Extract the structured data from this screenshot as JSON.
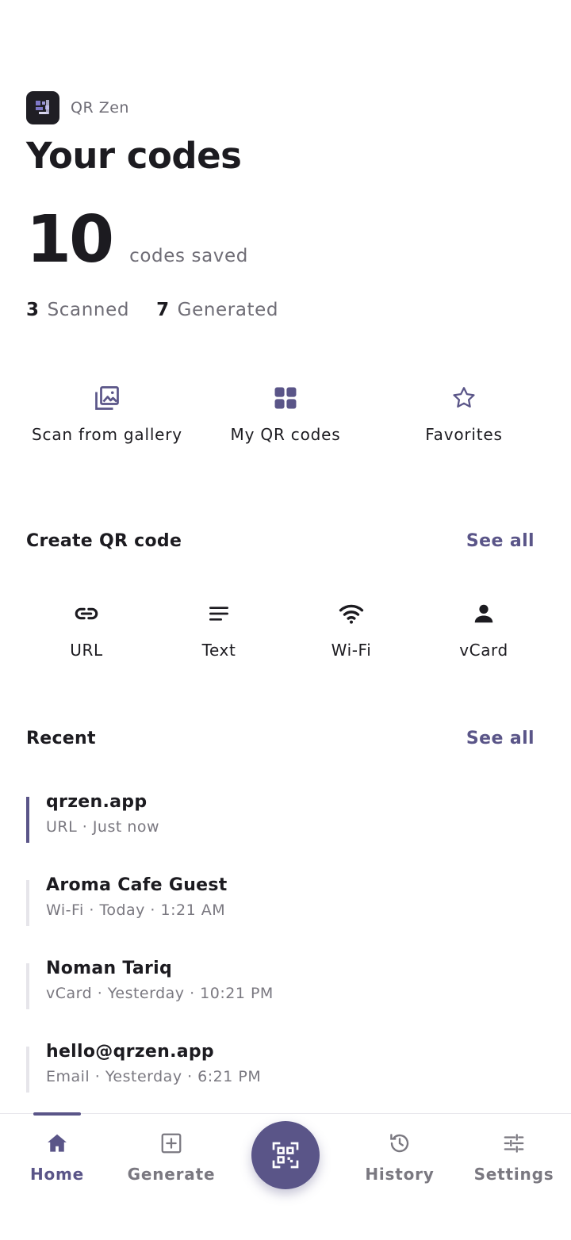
{
  "app": {
    "name": "QR Zen"
  },
  "page": {
    "title": "Your codes"
  },
  "summary": {
    "count": "10",
    "count_label": "codes saved"
  },
  "stats": [
    {
      "value": "3",
      "label": "Scanned"
    },
    {
      "value": "7",
      "label": "Generated"
    }
  ],
  "quick_actions": [
    {
      "label": "Scan from gallery",
      "icon": "gallery-icon"
    },
    {
      "label": "My QR codes",
      "icon": "grid-icon"
    },
    {
      "label": "Favorites",
      "icon": "star-icon"
    }
  ],
  "create": {
    "title": "Create QR code",
    "see_all": "See all",
    "items": [
      {
        "label": "URL",
        "icon": "link-icon"
      },
      {
        "label": "Text",
        "icon": "text-icon"
      },
      {
        "label": "Wi-Fi",
        "icon": "wifi-icon"
      },
      {
        "label": "vCard",
        "icon": "person-icon"
      }
    ]
  },
  "recent": {
    "title": "Recent",
    "see_all": "See all",
    "items": [
      {
        "title": "qrzen.app",
        "subtitle": "URL · Just now"
      },
      {
        "title": "Aroma Cafe Guest",
        "subtitle": "Wi-Fi · Today · 1:21 AM"
      },
      {
        "title": "Noman Tariq",
        "subtitle": "vCard · Yesterday · 10:21 PM"
      },
      {
        "title": "hello@qrzen.app",
        "subtitle": "Email · Yesterday · 6:21 PM"
      }
    ]
  },
  "nav": {
    "items": [
      {
        "label": "Home",
        "icon": "home-icon"
      },
      {
        "label": "Generate",
        "icon": "add-box-icon"
      },
      {
        "label": "History",
        "icon": "history-icon"
      },
      {
        "label": "Settings",
        "icon": "sliders-icon"
      }
    ],
    "fab_icon": "qr-scan-icon"
  },
  "colors": {
    "accent": "#5a5588",
    "text": "#1c1b20",
    "muted": "#6f6d76",
    "logo_bg": "#1f1e24"
  }
}
